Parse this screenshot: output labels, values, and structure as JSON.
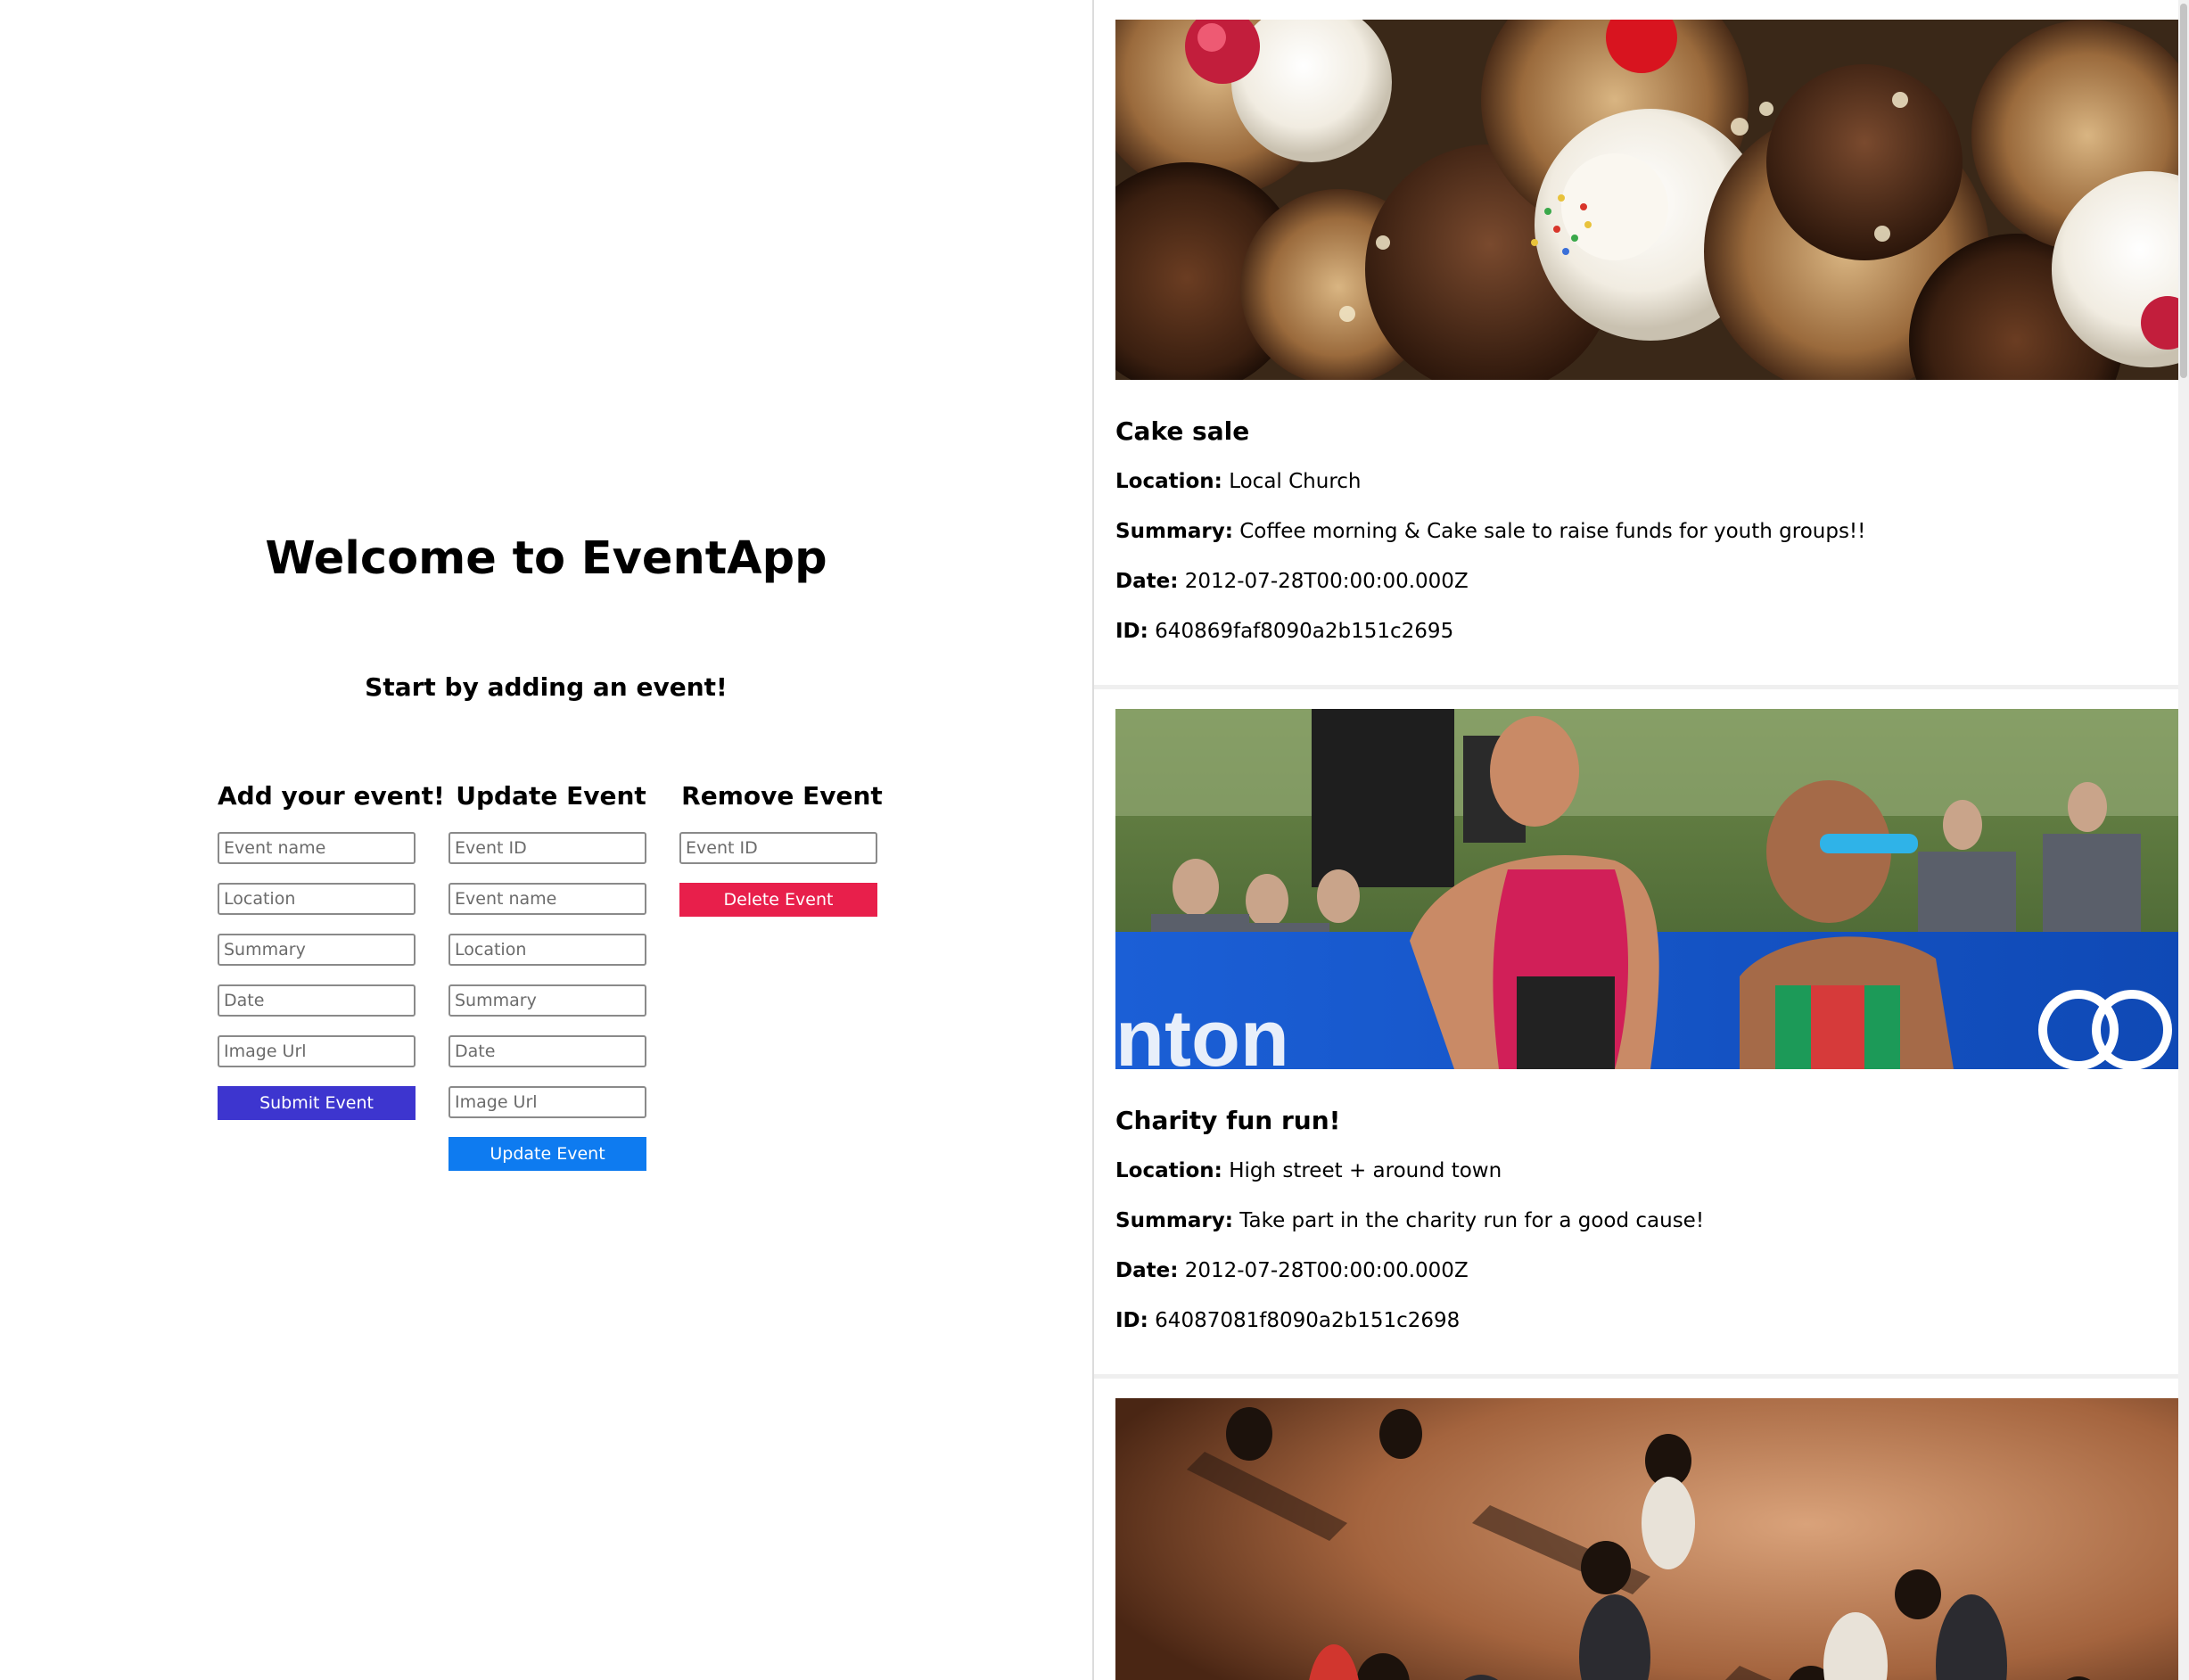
{
  "header": {
    "title": "Welcome to EventApp",
    "subtitle": "Start by adding an event!"
  },
  "add_form": {
    "heading": "Add your event!",
    "placeholders": [
      "Event name",
      "Location",
      "Summary",
      "Date",
      "Image Url"
    ],
    "submit_label": "Submit Event",
    "submit_color": "#3d35cf"
  },
  "update_form": {
    "heading": "Update Event",
    "placeholders": [
      "Event ID",
      "Event name",
      "Location",
      "Summary",
      "Date",
      "Image Url"
    ],
    "submit_label": "Update Event",
    "submit_color": "#0e7bf0"
  },
  "remove_form": {
    "heading": "Remove Event",
    "placeholders": [
      "Event ID"
    ],
    "submit_label": "Delete Event",
    "submit_color": "#e81f4b"
  },
  "field_labels": {
    "location": "Location:",
    "summary": "Summary:",
    "date": "Date:",
    "id": "ID:"
  },
  "events": [
    {
      "name": "Cake sale",
      "location": "Local Church",
      "summary": "Coffee morning & Cake sale to raise funds for youth groups!!",
      "date": "2012-07-28T00:00:00.000Z",
      "id": "640869faf8090a2b151c2695",
      "image": "cupcakes-photo"
    },
    {
      "name": "Charity fun run!",
      "location": "High street + around town",
      "summary": "Take part in the charity run for a good cause!",
      "date": "2012-07-28T00:00:00.000Z",
      "id": "64087081f8090a2b151c2698",
      "image": "runners-photo"
    },
    {
      "image": "dancing-crowd-photo"
    }
  ]
}
